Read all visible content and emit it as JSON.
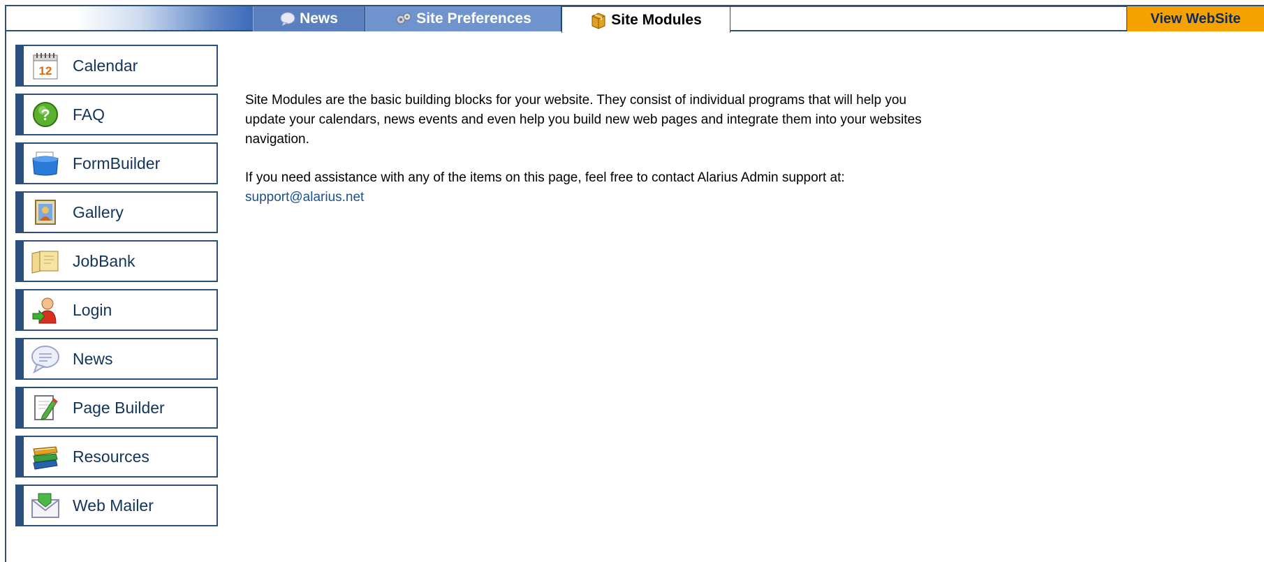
{
  "tabs": {
    "news": "News",
    "site_preferences": "Site Preferences",
    "site_modules": "Site Modules",
    "view_website": "View WebSite"
  },
  "modules": [
    {
      "label": "Calendar",
      "icon": "calendar-icon"
    },
    {
      "label": "FAQ",
      "icon": "question-icon"
    },
    {
      "label": "FormBuilder",
      "icon": "form-box-icon"
    },
    {
      "label": "Gallery",
      "icon": "picture-icon"
    },
    {
      "label": "JobBank",
      "icon": "folder-icon"
    },
    {
      "label": "Login",
      "icon": "user-login-icon"
    },
    {
      "label": "News",
      "icon": "speech-bubble-icon"
    },
    {
      "label": "Page Builder",
      "icon": "page-edit-icon"
    },
    {
      "label": "Resources",
      "icon": "books-icon"
    },
    {
      "label": "Web Mailer",
      "icon": "envelope-icon"
    }
  ],
  "calendar_day": "12",
  "intro": {
    "paragraph1_line1": "Site Modules are the basic building blocks for your website. They consist of individual programs that will help you",
    "paragraph1_line2": "update your calendars, news events and even help you build new web pages and integrate them into your websites",
    "paragraph1_line3": "navigation.",
    "paragraph2": "If you need assistance with any of the items on this page, feel free to contact Alarius Admin support at:",
    "support_email": "support@alarius.net"
  },
  "colors": {
    "border": "#2a4f7c",
    "tab_blue": "#5b80c0",
    "view_website_bg": "#f5a200",
    "link": "#1c4f8c"
  }
}
